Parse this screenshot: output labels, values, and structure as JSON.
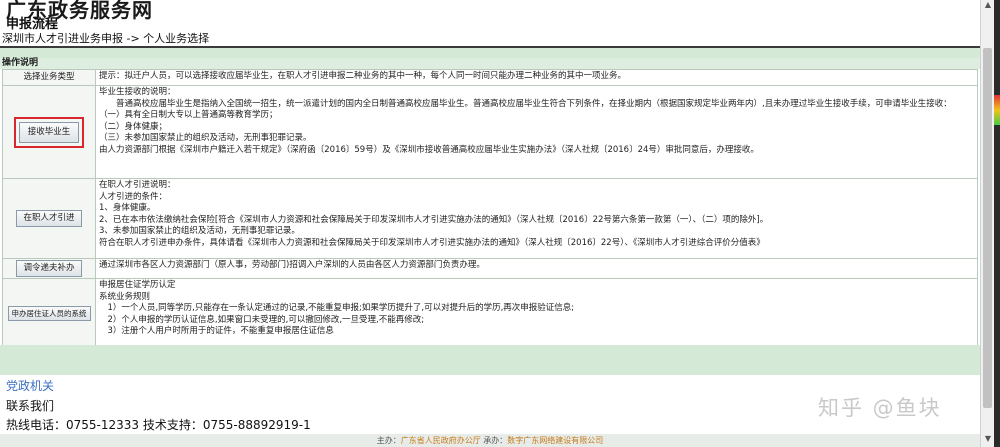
{
  "header": {
    "site_title": "广东政务服务网",
    "flow_title": "申报流程",
    "breadcrumb": "深圳市人才引进业务申报 -> 个人业务选择"
  },
  "section": {
    "title": "操作说明"
  },
  "rows": [
    {
      "left": "选择业务类型",
      "lines": [
        "提示：拟迁户人员，可以选择接收应届毕业生，在职人才引进申报二种业务的其中一种，每个人同一时间只能办理二种业务的其中一项业务。"
      ]
    },
    {
      "button": "接收毕业生",
      "lines": [
        "毕业生接收的说明：",
        "　　普通高校应届毕业生是指纳入全国统一招生，统一派遣计划的国内全日制普通高校应届毕业生。普通高校应届毕业生符合下列条件，在择业期内（根据国家规定毕业两年内）,且未办理过毕业生接收手续，可申请毕业生接收：",
        "（一）具有全日制大专以上普通高等教育学历；",
        "（二）身体健康；",
        "（三）未参加国家禁止的组织及活动，无刑事犯罪记录。",
        "由人力资源部门根据《深圳市户籍迁入若干规定》（深府函〔2016〕59号）及《深圳市接收普通高校应届毕业生实施办法》（深人社规〔2016〕24号）审批同意后，办理接收。"
      ]
    },
    {
      "button": "在职人才引进",
      "lines": [
        "在职人才引进说明：",
        "人才引进的条件：",
        "1、身体健康。",
        "2、已在本市依法缴纳社会保险[符合《深圳市人力资源和社会保障局关于印发深圳市人才引进实施办法的通知》（深人社规〔2016〕22号第六条第一款第（一）、（二）项的除外]。",
        "3、未参加国家禁止的组织及活动，无刑事犯罪记录。",
        "符合在职人才引进申办条件，具体请看《深圳市人力资源和社会保障局关于印发深圳市人才引进实施办法的通知》（深人社规〔2016〕22号）、《深圳市人才引进综合评价分值表》"
      ]
    },
    {
      "button": "调令递夫补办",
      "lines": [
        "通过深圳市各区人力资源部门（原人事，劳动部门)招调入户深圳的人员由各区人力资源部门负责办理。"
      ]
    },
    {
      "button": "申办居住证人员的系统",
      "lines": [
        "申报居住证学历认定",
        "系统业务规则",
        "　1）一个人员,同等学历,只能存在一条认定通过的记录,不能重复申报;如果学历提升了,可以对提升后的学历,再次申报验证信息;",
        "　2）个人申报的学历认证信息,如果窗口未受理的,可以撤回修改,一旦受理,不能再修改;",
        "　3）注册个人用户时所用于的证件，不能重复申报居住证信息"
      ]
    }
  ],
  "footer": {
    "link": "党政机关",
    "contact": "联系我们",
    "phone": "热线电话：0755-12333 技术支持：0755-88892919-1",
    "host_label": "主办：",
    "host_org": "广东省人民政府办公厅",
    "undertake_label": " 承办：",
    "undertake_org": "数字广东网络建设有限公司"
  },
  "watermark": "知乎 @鱼块",
  "colors": {
    "highlight": "#d9272e",
    "green_band": "#d4ead7",
    "link": "#3b6fc0"
  }
}
